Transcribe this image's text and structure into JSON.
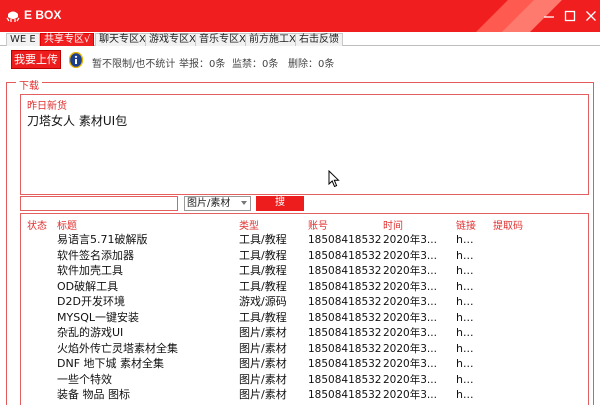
{
  "window": {
    "title": "E BOX",
    "controls": [
      "minimize-icon",
      "maximize-icon",
      "close-icon"
    ],
    "accent_color": "#f01e1e"
  },
  "tabs": [
    {
      "label": "WE E",
      "active": false
    },
    {
      "label": "共享专区√",
      "active": true
    },
    {
      "label": "聊天专区X",
      "active": false
    },
    {
      "label": "游戏专区X",
      "active": false
    },
    {
      "label": "音乐专区X",
      "active": false
    },
    {
      "label": "前方施工X",
      "active": false
    },
    {
      "label": "右击反馈",
      "active": false
    }
  ],
  "toolbar": {
    "upload_label": "我要上传",
    "info_icon": "info-icon",
    "limit_text": "暂不限制/也不统计",
    "report_text": "举报：0条",
    "watch_text": "监禁：0条",
    "delete_text": "删除：0条"
  },
  "download": {
    "group_label": "下载",
    "news_label": "昨日新货",
    "news_text": "刀塔女人 素材UI包"
  },
  "search": {
    "input_value": "",
    "category_selected": "图片/素材",
    "button_label": "搜"
  },
  "table": {
    "headers": {
      "status": "状态",
      "title": "标题",
      "type": "类型",
      "account": "账号",
      "time": "时间",
      "link": "链接",
      "code": "提取码"
    },
    "rows": [
      {
        "status": "",
        "title": "易语言5.71破解版",
        "type": "工具/教程",
        "account": "18508418532",
        "time": "2020年3...",
        "link": "h...",
        "code": ""
      },
      {
        "status": "",
        "title": "软件签名添加器",
        "type": "工具/教程",
        "account": "18508418532",
        "time": "2020年3...",
        "link": "h...",
        "code": ""
      },
      {
        "status": "",
        "title": "软件加壳工具",
        "type": "工具/教程",
        "account": "18508418532",
        "time": "2020年3...",
        "link": "h...",
        "code": ""
      },
      {
        "status": "",
        "title": "OD破解工具",
        "type": "工具/教程",
        "account": "18508418532",
        "time": "2020年3...",
        "link": "h...",
        "code": ""
      },
      {
        "status": "",
        "title": "D2D开发环境",
        "type": "游戏/源码",
        "account": "18508418532",
        "time": "2020年3...",
        "link": "h...",
        "code": ""
      },
      {
        "status": "",
        "title": "MYSQL一键安装",
        "type": "工具/教程",
        "account": "18508418532",
        "time": "2020年3...",
        "link": "h...",
        "code": ""
      },
      {
        "status": "",
        "title": "杂乱的游戏UI",
        "type": "图片/素材",
        "account": "18508418532",
        "time": "2020年3...",
        "link": "h...",
        "code": ""
      },
      {
        "status": "",
        "title": "火焰外传亡灵塔素材全集",
        "type": "图片/素材",
        "account": "18508418532",
        "time": "2020年3...",
        "link": "h...",
        "code": ""
      },
      {
        "status": "",
        "title": "DNF 地下城 素材全集",
        "type": "图片/素材",
        "account": "18508418532",
        "time": "2020年3...",
        "link": "h...",
        "code": ""
      },
      {
        "status": "",
        "title": "一些个特效",
        "type": "图片/素材",
        "account": "18508418532",
        "time": "2020年3...",
        "link": "h...",
        "code": ""
      },
      {
        "status": "",
        "title": "装备 物品 图标",
        "type": "图片/素材",
        "account": "18508418532",
        "time": "2020年3...",
        "link": "h...",
        "code": ""
      }
    ]
  }
}
